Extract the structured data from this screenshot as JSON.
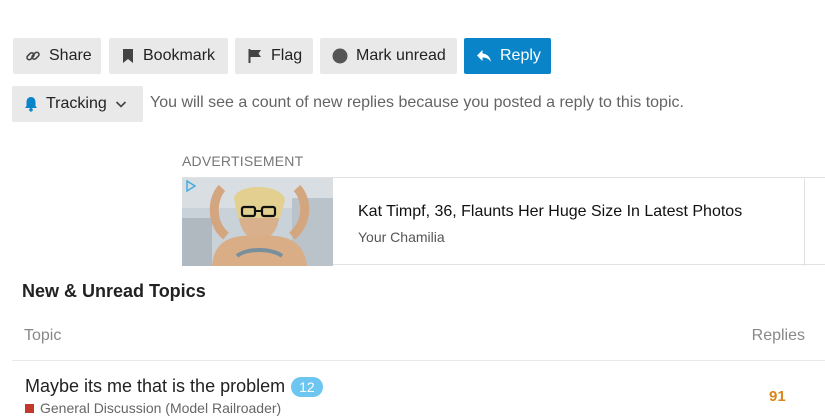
{
  "actions": {
    "share_label": "Share",
    "bookmark_label": "Bookmark",
    "flag_label": "Flag",
    "mark_unread_label": "Mark unread",
    "reply_label": "Reply"
  },
  "tracking": {
    "label": "Tracking",
    "description": "You will see a count of new replies because you posted a reply to this topic."
  },
  "advertisement": {
    "label": "ADVERTISEMENT",
    "title": "Kat Timpf, 36, Flaunts Her Huge Size In Latest Photos",
    "source": "Your Chamilia"
  },
  "new_unread": {
    "heading": "New & Unread Topics",
    "columns": {
      "topic": "Topic",
      "replies": "Replies"
    },
    "topics": [
      {
        "title": "Maybe its me that is the problem",
        "unread_count": "12",
        "category": "General Discussion (Model Railroader)",
        "replies": "91"
      }
    ]
  },
  "colors": {
    "primary_button": "#0a84c8",
    "button_gray": "#e9e9e9",
    "badge": "#6cc6f0",
    "replies_highlight": "#d9861a",
    "category_swatch": "#c0392b"
  },
  "icons": {
    "share": "link-icon",
    "bookmark": "bookmark-icon",
    "flag": "flag-icon",
    "mark_unread": "circle-icon",
    "reply": "reply-icon",
    "tracking": "bell-icon",
    "tracking_chevron": "chevron-down-icon",
    "ad_badge": "ad-choices-icon"
  }
}
